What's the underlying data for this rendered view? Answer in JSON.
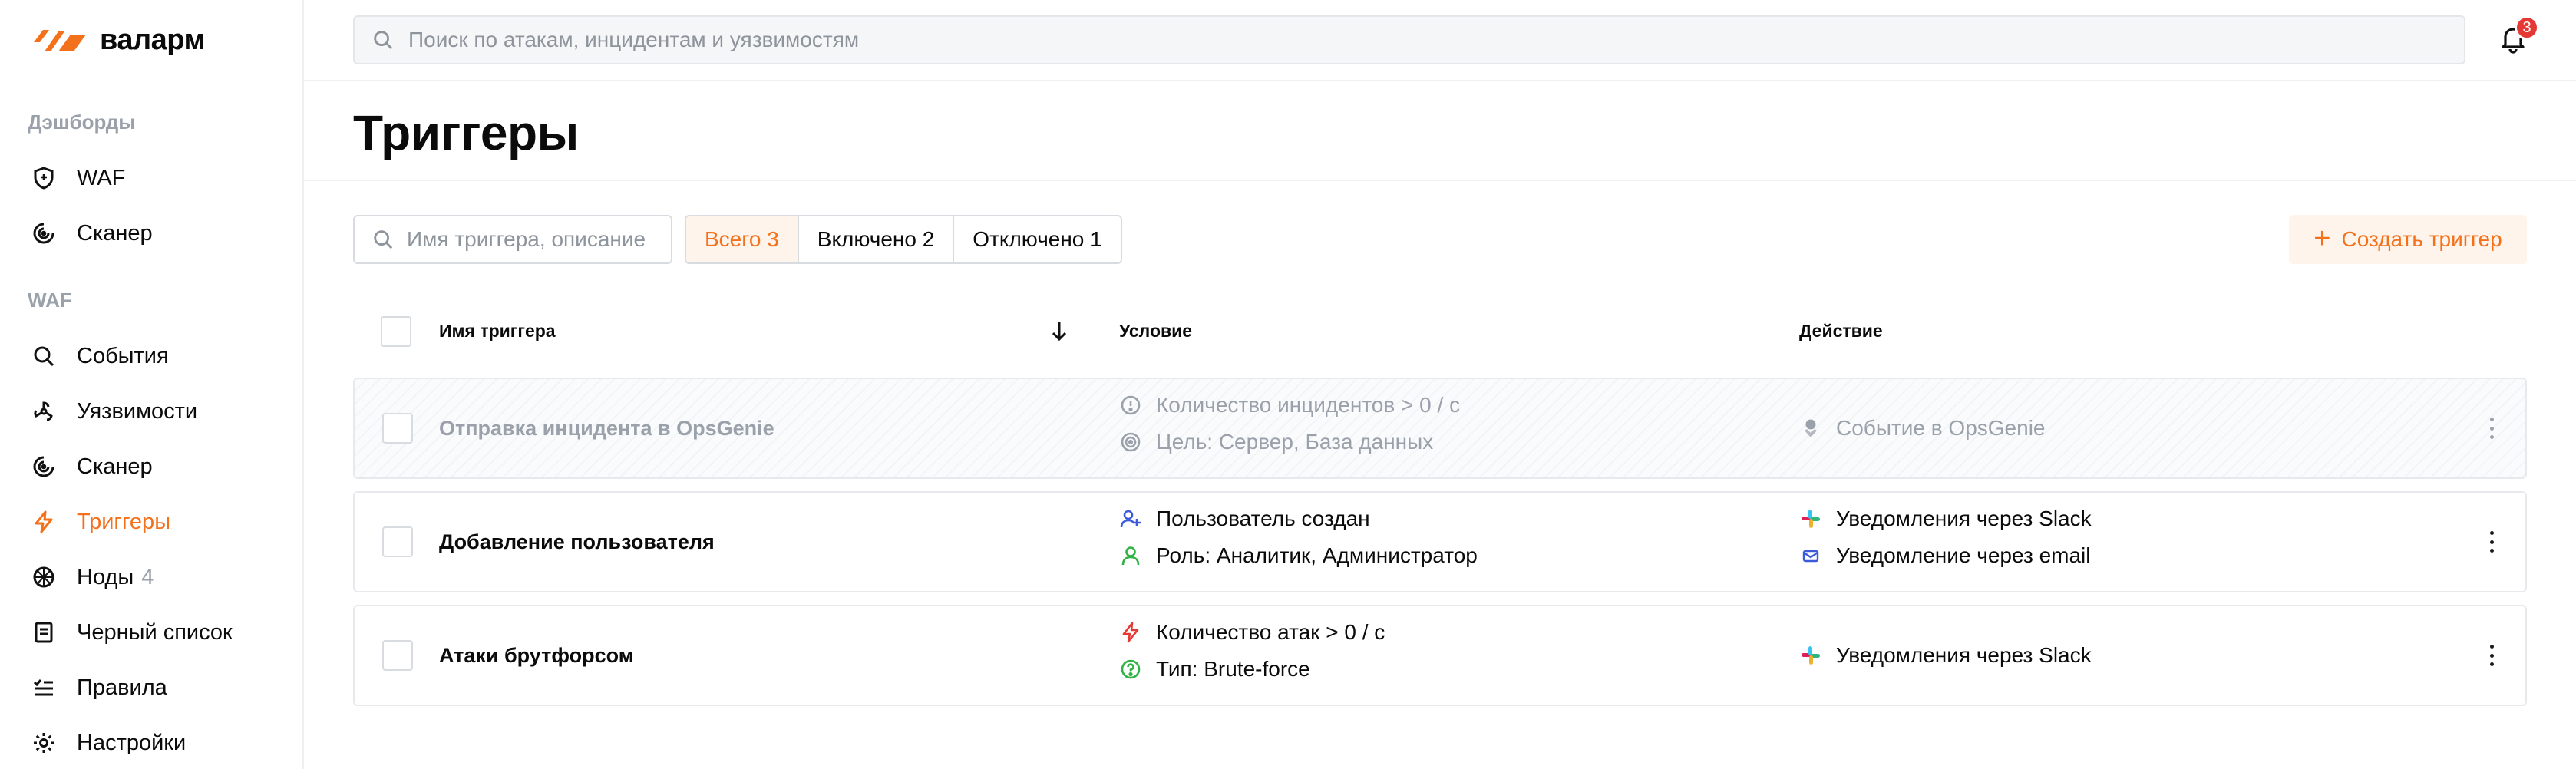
{
  "brand": {
    "name": "валарм",
    "accent": "#f3711b"
  },
  "sidebar": {
    "sections": [
      {
        "label": "Дэшборды"
      },
      {
        "label": "WAF"
      }
    ],
    "items": [
      {
        "label": "WAF",
        "icon": "shield-icon"
      },
      {
        "label": "Сканер",
        "icon": "radar-icon"
      },
      {
        "label": "События",
        "icon": "search-icon"
      },
      {
        "label": "Уязвимости",
        "icon": "biohazard-icon"
      },
      {
        "label": "Сканер",
        "icon": "radar-icon"
      },
      {
        "label": "Триггеры",
        "icon": "lightning-icon",
        "active": true
      },
      {
        "label": "Ноды",
        "icon": "node-icon",
        "count": "4"
      },
      {
        "label": "Черный список",
        "icon": "blocklist-icon"
      },
      {
        "label": "Правила",
        "icon": "rules-icon"
      },
      {
        "label": "Настройки",
        "icon": "gear-icon"
      }
    ]
  },
  "topbar": {
    "search_placeholder": "Поиск по атакам, инцидентам и уязвимостям",
    "notifications_count": "3"
  },
  "page": {
    "title": "Триггеры"
  },
  "filters": {
    "search_placeholder": "Имя триггера, описание",
    "segments": [
      {
        "label": "Всего 3",
        "active": true
      },
      {
        "label": "Включено 2"
      },
      {
        "label": "Отключено 1"
      }
    ],
    "create_label": "Создать триггер"
  },
  "table": {
    "columns": {
      "name": "Имя триггера",
      "condition": "Условие",
      "action": "Действие"
    },
    "rows": [
      {
        "name": "Отправка инцидента в OpsGenie",
        "disabled": true,
        "conditions": [
          {
            "icon": "alert-circle-icon",
            "text": "Количество инцидентов > 0 / с"
          },
          {
            "icon": "target-icon",
            "text": "Цель: Сервер, База данных"
          }
        ],
        "actions": [
          {
            "icon": "opsgenie-icon",
            "text": "Событие в OpsGenie"
          }
        ]
      },
      {
        "name": "Добавление пользователя",
        "disabled": false,
        "conditions": [
          {
            "icon": "user-add-icon",
            "text": "Пользователь создан"
          },
          {
            "icon": "user-icon",
            "text": "Роль: Аналитик, Администратор"
          }
        ],
        "actions": [
          {
            "icon": "slack-icon",
            "text": "Уведомления через Slack"
          },
          {
            "icon": "mail-icon",
            "text": "Уведомление через email"
          }
        ]
      },
      {
        "name": "Атаки брутфорсом",
        "disabled": false,
        "conditions": [
          {
            "icon": "lightning-icon",
            "text": "Количество атак > 0 / с"
          },
          {
            "icon": "question-circle-icon",
            "text": "Тип: Brute-force"
          }
        ],
        "actions": [
          {
            "icon": "slack-icon",
            "text": "Уведомления через Slack"
          }
        ]
      }
    ]
  }
}
